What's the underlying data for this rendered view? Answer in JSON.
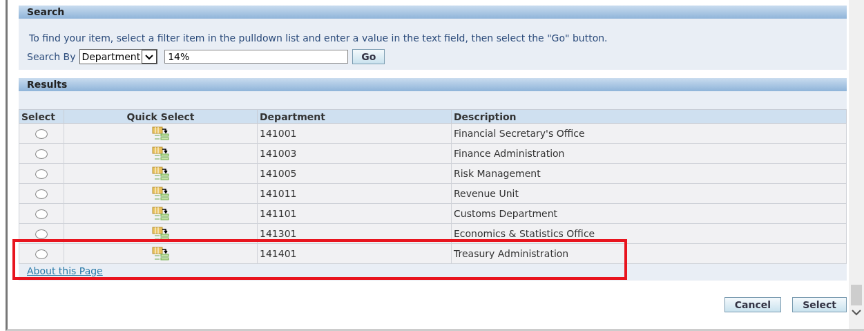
{
  "search": {
    "title": "Search",
    "instructions": "To find your item, select a filter item in the pulldown list and enter a value in the text field, then select the \"Go\" button.",
    "search_by_label": "Search By",
    "filter": "Department",
    "value": "14%",
    "go_button": "Go"
  },
  "results": {
    "title": "Results",
    "columns": [
      "Select",
      "Quick Select",
      "Department",
      "Description"
    ],
    "rows": [
      {
        "selected": false,
        "department": "141001",
        "description": "Financial Secretary's Office"
      },
      {
        "selected": false,
        "department": "141003",
        "description": "Finance Administration"
      },
      {
        "selected": false,
        "department": "141005",
        "description": "Risk Management"
      },
      {
        "selected": false,
        "department": "141011",
        "description": "Revenue Unit"
      },
      {
        "selected": false,
        "department": "141101",
        "description": "Customs Department"
      },
      {
        "selected": false,
        "department": "141301",
        "description": "Economics & Statistics Office"
      },
      {
        "selected": false,
        "department": "141401",
        "description": "Treasury Administration"
      }
    ],
    "about_link": "About this Page"
  },
  "buttons": [
    "Cancel",
    "Select"
  ]
}
